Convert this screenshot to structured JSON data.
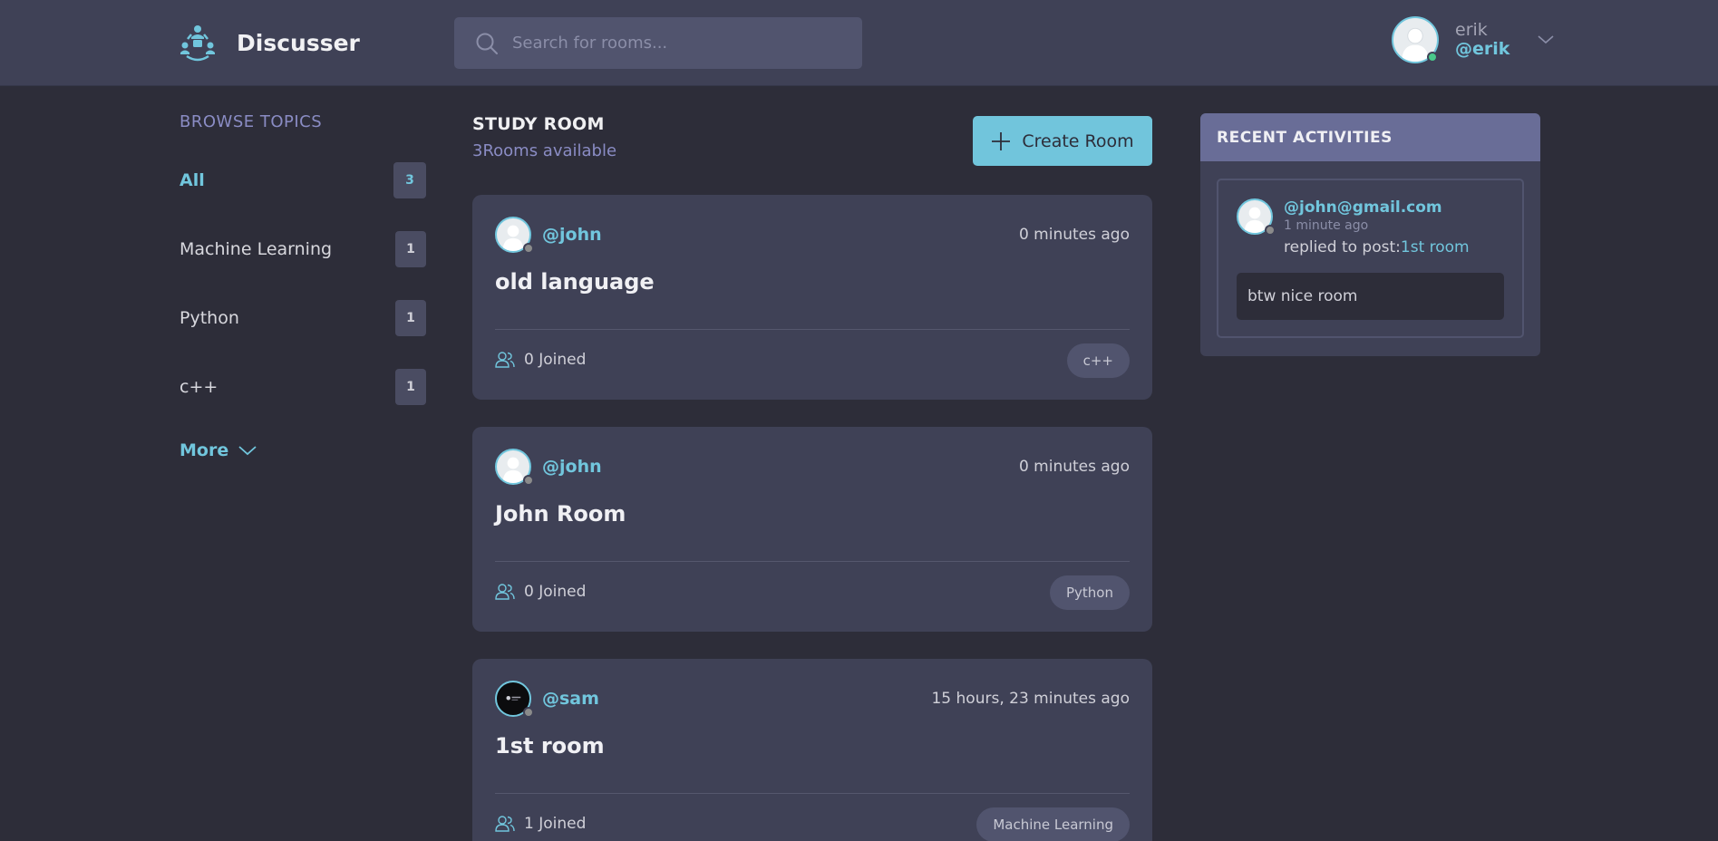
{
  "app": {
    "brand_name": "Discusser",
    "accent_color": "#71c6dd",
    "background_color": "#2d2d39",
    "card_color": "#3f4156"
  },
  "header": {
    "search": {
      "placeholder": "Search for rooms..."
    },
    "user": {
      "name": "erik",
      "handle": "@erik",
      "status": "online"
    }
  },
  "sidebar": {
    "title": "BROWSE TOPICS",
    "topics": [
      {
        "name": "All",
        "count": "3",
        "active": true
      },
      {
        "name": "Machine Learning",
        "count": "1",
        "active": false
      },
      {
        "name": "Python",
        "count": "1",
        "active": false
      },
      {
        "name": "c++",
        "count": "1",
        "active": false
      }
    ],
    "more_label": "More"
  },
  "main": {
    "title": "STUDY ROOM",
    "subtitle": "3Rooms available",
    "create_label": "Create Room",
    "rooms": [
      {
        "host": "@john",
        "time": "0 minutes ago",
        "name": "old language",
        "joined": "0 Joined",
        "topic": "c++",
        "avatar": "default"
      },
      {
        "host": "@john",
        "time": "0 minutes ago",
        "name": "John Room",
        "joined": "0 Joined",
        "topic": "Python",
        "avatar": "default"
      },
      {
        "host": "@sam",
        "time": "15 hours, 23 minutes ago",
        "name": "1st room",
        "joined": "1 Joined",
        "topic": "Machine Learning",
        "avatar": "dark"
      }
    ]
  },
  "activity": {
    "title": "RECENT ACTIVITIES",
    "items": [
      {
        "user": "@john@gmail.com",
        "time": "1 minute ago",
        "action": "replied to post:",
        "post": "1st room",
        "message": "btw nice room"
      }
    ]
  }
}
